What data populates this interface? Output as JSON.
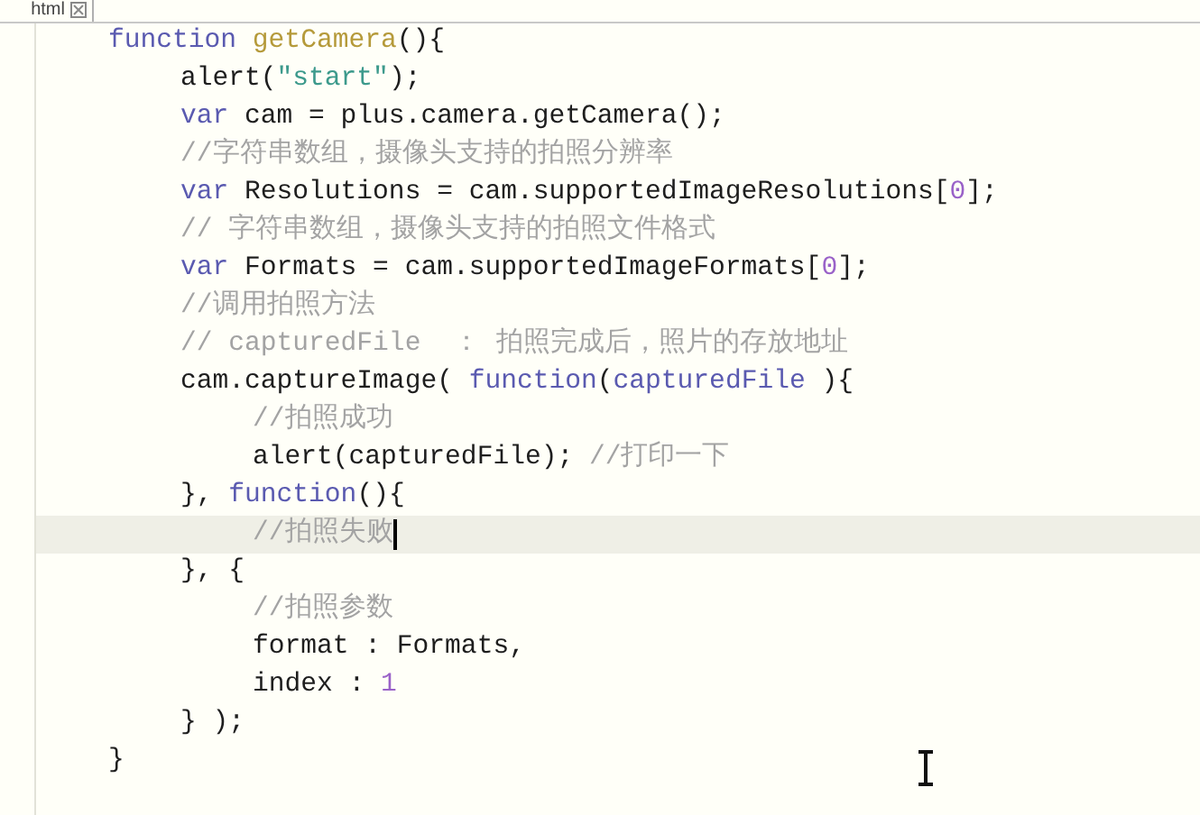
{
  "tab": {
    "label": "html",
    "selected": true
  },
  "lines": [
    {
      "current": false,
      "tokens": [
        {
          "kind": "keyword",
          "text": "function"
        },
        {
          "kind": "name",
          "text": " getCamera"
        },
        {
          "kind": "plain",
          "text": "(){"
        }
      ],
      "children": [
        {
          "current": false,
          "tokens": [
            {
              "kind": "plain",
              "text": "alert("
            },
            {
              "kind": "string",
              "text": "\"start\""
            },
            {
              "kind": "plain",
              "text": ");"
            }
          ]
        },
        {
          "current": false,
          "tokens": [
            {
              "kind": "keyword",
              "text": "var"
            },
            {
              "kind": "plain",
              "text": " cam = plus.camera.getCamera();"
            }
          ]
        },
        {
          "current": false,
          "tokens": [
            {
              "kind": "comment",
              "text": "//字符串数组，摄像头支持的拍照分辨率"
            }
          ]
        },
        {
          "current": false,
          "tokens": [
            {
              "kind": "keyword",
              "text": "var"
            },
            {
              "kind": "plain",
              "text": " Resolutions = cam.supportedImageResolutions["
            },
            {
              "kind": "number",
              "text": "0"
            },
            {
              "kind": "plain",
              "text": "];"
            }
          ]
        },
        {
          "current": false,
          "tokens": [
            {
              "kind": "comment",
              "text": "// 字符串数组，摄像头支持的拍照文件格式"
            }
          ]
        },
        {
          "current": false,
          "tokens": [
            {
              "kind": "keyword",
              "text": "var"
            },
            {
              "kind": "plain",
              "text": " Formats = cam.supportedImageFormats["
            },
            {
              "kind": "number",
              "text": "0"
            },
            {
              "kind": "plain",
              "text": "];"
            }
          ]
        },
        {
          "current": false,
          "tokens": [
            {
              "kind": "comment",
              "text": "//调用拍照方法"
            }
          ]
        },
        {
          "current": false,
          "tokens": [
            {
              "kind": "comment",
              "text": "// capturedFile  ： 拍照完成后，照片的存放地址"
            }
          ]
        },
        {
          "current": false,
          "tokens": [
            {
              "kind": "plain",
              "text": "cam.captureImage( "
            },
            {
              "kind": "keyword",
              "text": "function"
            },
            {
              "kind": "plain",
              "text": "("
            },
            {
              "kind": "param",
              "text": "capturedFile"
            },
            {
              "kind": "plain",
              "text": " ){"
            }
          ],
          "children": [
            {
              "current": false,
              "tokens": [
                {
                  "kind": "comment",
                  "text": "//拍照成功"
                }
              ]
            },
            {
              "current": false,
              "tokens": [
                {
                  "kind": "plain",
                  "text": "alert(capturedFile); "
                },
                {
                  "kind": "comment",
                  "text": "//打印一下"
                }
              ]
            }
          ]
        },
        {
          "current": false,
          "tokens": [
            {
              "kind": "plain",
              "text": "}, "
            },
            {
              "kind": "keyword",
              "text": "function"
            },
            {
              "kind": "plain",
              "text": "(){"
            }
          ],
          "children": [
            {
              "current": true,
              "tokens": [
                {
                  "kind": "comment",
                  "text": "//拍照失败"
                }
              ]
            }
          ]
        },
        {
          "current": false,
          "tokens": [
            {
              "kind": "plain",
              "text": "}, {"
            }
          ],
          "children": [
            {
              "current": false,
              "tokens": [
                {
                  "kind": "comment",
                  "text": "//拍照参数"
                }
              ]
            },
            {
              "current": false,
              "tokens": [
                {
                  "kind": "plain",
                  "text": "format : Formats,"
                }
              ]
            },
            {
              "current": false,
              "tokens": [
                {
                  "kind": "plain",
                  "text": "index : "
                },
                {
                  "kind": "number",
                  "text": "1"
                }
              ]
            }
          ]
        },
        {
          "current": false,
          "tokens": [
            {
              "kind": "plain",
              "text": "} );"
            }
          ]
        }
      ]
    },
    {
      "current": false,
      "tokens": [
        {
          "kind": "plain",
          "text": "}"
        }
      ]
    }
  ]
}
